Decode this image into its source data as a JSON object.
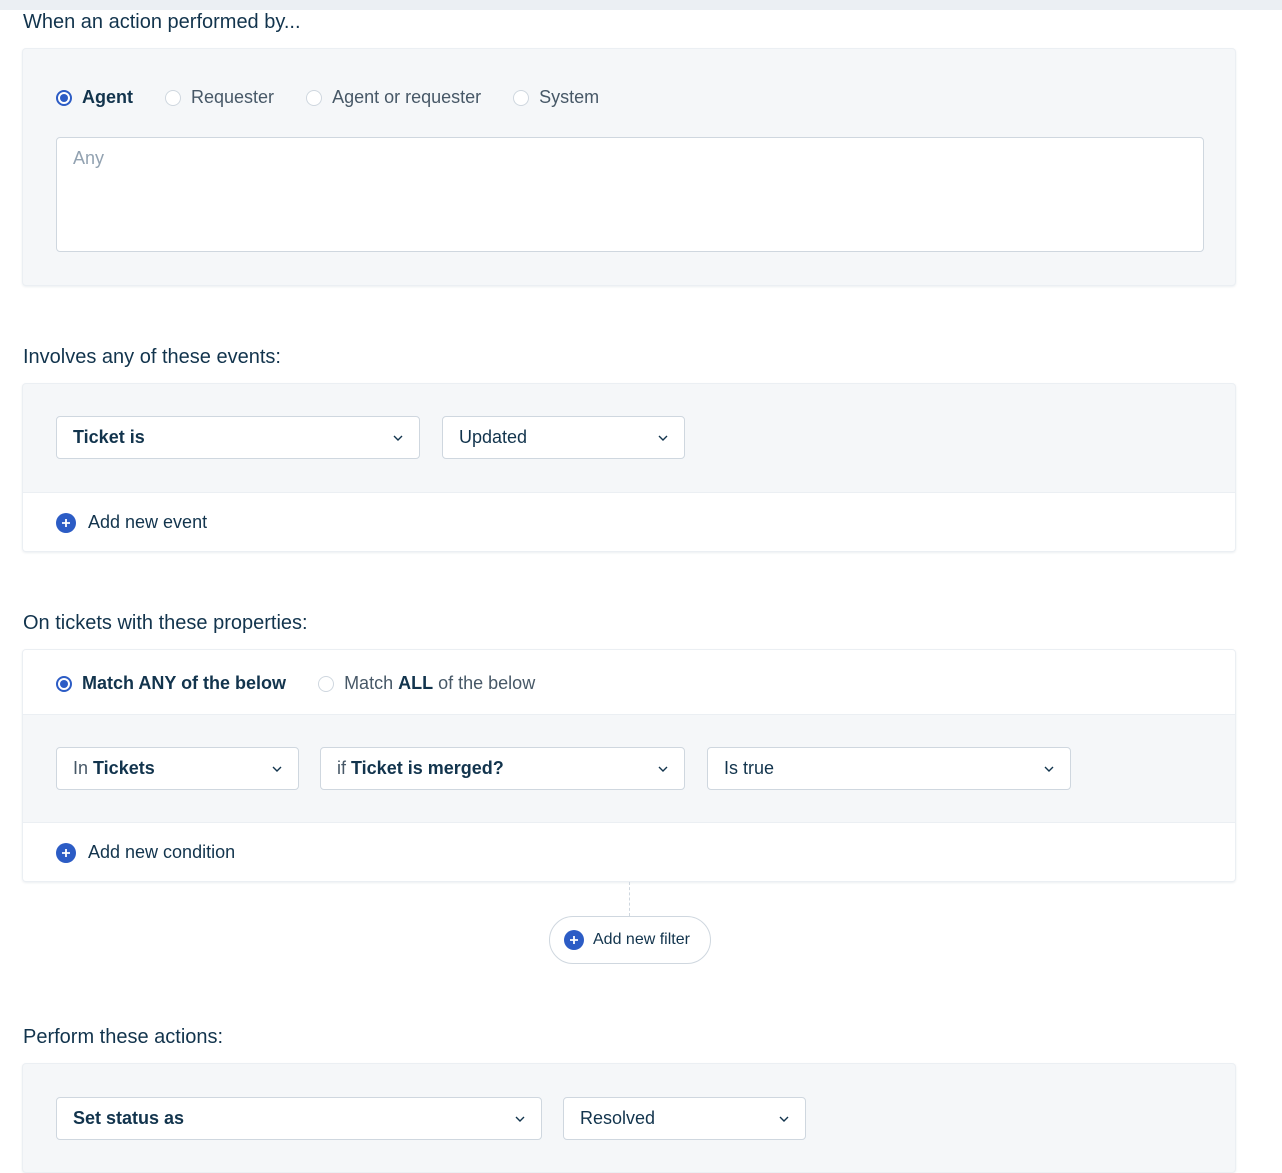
{
  "performed_by": {
    "title": "When an action performed by...",
    "options": [
      "Agent",
      "Requester",
      "Agent or requester",
      "System"
    ],
    "selected": "Agent",
    "input_placeholder": "Any"
  },
  "events": {
    "title": "Involves any of these events:",
    "field": "Ticket is",
    "value": "Updated",
    "add_label": "Add new event"
  },
  "properties": {
    "title": "On tickets with these properties:",
    "match_any": {
      "pre": "Match",
      "keyword": "ANY",
      "post": "of the below"
    },
    "match_all": {
      "pre": "Match",
      "keyword": "ALL",
      "post": "of the below"
    },
    "condition": {
      "scope_prefix": "In",
      "scope": "Tickets",
      "field_prefix": "if",
      "field": "Ticket is merged?",
      "value": "Is true"
    },
    "add_condition_label": "Add new condition",
    "add_filter_label": "Add new filter"
  },
  "actions": {
    "title": "Perform these actions:",
    "field": "Set status as",
    "value": "Resolved"
  },
  "colors": {
    "accent": "#2c5cc5",
    "text": "#12344d",
    "muted": "#475867",
    "border": "#cfd7df",
    "panel": "#f5f7f9"
  }
}
